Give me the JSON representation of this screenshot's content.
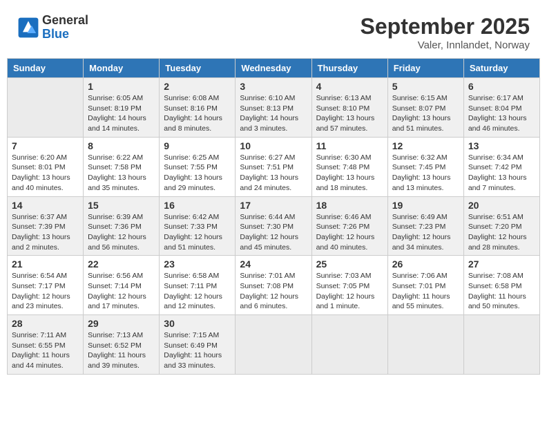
{
  "header": {
    "logo_general": "General",
    "logo_blue": "Blue",
    "month_title": "September 2025",
    "location": "Valer, Innlandet, Norway"
  },
  "weekdays": [
    "Sunday",
    "Monday",
    "Tuesday",
    "Wednesday",
    "Thursday",
    "Friday",
    "Saturday"
  ],
  "weeks": [
    [
      {
        "day": "",
        "info": ""
      },
      {
        "day": "1",
        "info": "Sunrise: 6:05 AM\nSunset: 8:19 PM\nDaylight: 14 hours\nand 14 minutes."
      },
      {
        "day": "2",
        "info": "Sunrise: 6:08 AM\nSunset: 8:16 PM\nDaylight: 14 hours\nand 8 minutes."
      },
      {
        "day": "3",
        "info": "Sunrise: 6:10 AM\nSunset: 8:13 PM\nDaylight: 14 hours\nand 3 minutes."
      },
      {
        "day": "4",
        "info": "Sunrise: 6:13 AM\nSunset: 8:10 PM\nDaylight: 13 hours\nand 57 minutes."
      },
      {
        "day": "5",
        "info": "Sunrise: 6:15 AM\nSunset: 8:07 PM\nDaylight: 13 hours\nand 51 minutes."
      },
      {
        "day": "6",
        "info": "Sunrise: 6:17 AM\nSunset: 8:04 PM\nDaylight: 13 hours\nand 46 minutes."
      }
    ],
    [
      {
        "day": "7",
        "info": "Sunrise: 6:20 AM\nSunset: 8:01 PM\nDaylight: 13 hours\nand 40 minutes."
      },
      {
        "day": "8",
        "info": "Sunrise: 6:22 AM\nSunset: 7:58 PM\nDaylight: 13 hours\nand 35 minutes."
      },
      {
        "day": "9",
        "info": "Sunrise: 6:25 AM\nSunset: 7:55 PM\nDaylight: 13 hours\nand 29 minutes."
      },
      {
        "day": "10",
        "info": "Sunrise: 6:27 AM\nSunset: 7:51 PM\nDaylight: 13 hours\nand 24 minutes."
      },
      {
        "day": "11",
        "info": "Sunrise: 6:30 AM\nSunset: 7:48 PM\nDaylight: 13 hours\nand 18 minutes."
      },
      {
        "day": "12",
        "info": "Sunrise: 6:32 AM\nSunset: 7:45 PM\nDaylight: 13 hours\nand 13 minutes."
      },
      {
        "day": "13",
        "info": "Sunrise: 6:34 AM\nSunset: 7:42 PM\nDaylight: 13 hours\nand 7 minutes."
      }
    ],
    [
      {
        "day": "14",
        "info": "Sunrise: 6:37 AM\nSunset: 7:39 PM\nDaylight: 13 hours\nand 2 minutes."
      },
      {
        "day": "15",
        "info": "Sunrise: 6:39 AM\nSunset: 7:36 PM\nDaylight: 12 hours\nand 56 minutes."
      },
      {
        "day": "16",
        "info": "Sunrise: 6:42 AM\nSunset: 7:33 PM\nDaylight: 12 hours\nand 51 minutes."
      },
      {
        "day": "17",
        "info": "Sunrise: 6:44 AM\nSunset: 7:30 PM\nDaylight: 12 hours\nand 45 minutes."
      },
      {
        "day": "18",
        "info": "Sunrise: 6:46 AM\nSunset: 7:26 PM\nDaylight: 12 hours\nand 40 minutes."
      },
      {
        "day": "19",
        "info": "Sunrise: 6:49 AM\nSunset: 7:23 PM\nDaylight: 12 hours\nand 34 minutes."
      },
      {
        "day": "20",
        "info": "Sunrise: 6:51 AM\nSunset: 7:20 PM\nDaylight: 12 hours\nand 28 minutes."
      }
    ],
    [
      {
        "day": "21",
        "info": "Sunrise: 6:54 AM\nSunset: 7:17 PM\nDaylight: 12 hours\nand 23 minutes."
      },
      {
        "day": "22",
        "info": "Sunrise: 6:56 AM\nSunset: 7:14 PM\nDaylight: 12 hours\nand 17 minutes."
      },
      {
        "day": "23",
        "info": "Sunrise: 6:58 AM\nSunset: 7:11 PM\nDaylight: 12 hours\nand 12 minutes."
      },
      {
        "day": "24",
        "info": "Sunrise: 7:01 AM\nSunset: 7:08 PM\nDaylight: 12 hours\nand 6 minutes."
      },
      {
        "day": "25",
        "info": "Sunrise: 7:03 AM\nSunset: 7:05 PM\nDaylight: 12 hours\nand 1 minute."
      },
      {
        "day": "26",
        "info": "Sunrise: 7:06 AM\nSunset: 7:01 PM\nDaylight: 11 hours\nand 55 minutes."
      },
      {
        "day": "27",
        "info": "Sunrise: 7:08 AM\nSunset: 6:58 PM\nDaylight: 11 hours\nand 50 minutes."
      }
    ],
    [
      {
        "day": "28",
        "info": "Sunrise: 7:11 AM\nSunset: 6:55 PM\nDaylight: 11 hours\nand 44 minutes."
      },
      {
        "day": "29",
        "info": "Sunrise: 7:13 AM\nSunset: 6:52 PM\nDaylight: 11 hours\nand 39 minutes."
      },
      {
        "day": "30",
        "info": "Sunrise: 7:15 AM\nSunset: 6:49 PM\nDaylight: 11 hours\nand 33 minutes."
      },
      {
        "day": "",
        "info": ""
      },
      {
        "day": "",
        "info": ""
      },
      {
        "day": "",
        "info": ""
      },
      {
        "day": "",
        "info": ""
      }
    ]
  ]
}
